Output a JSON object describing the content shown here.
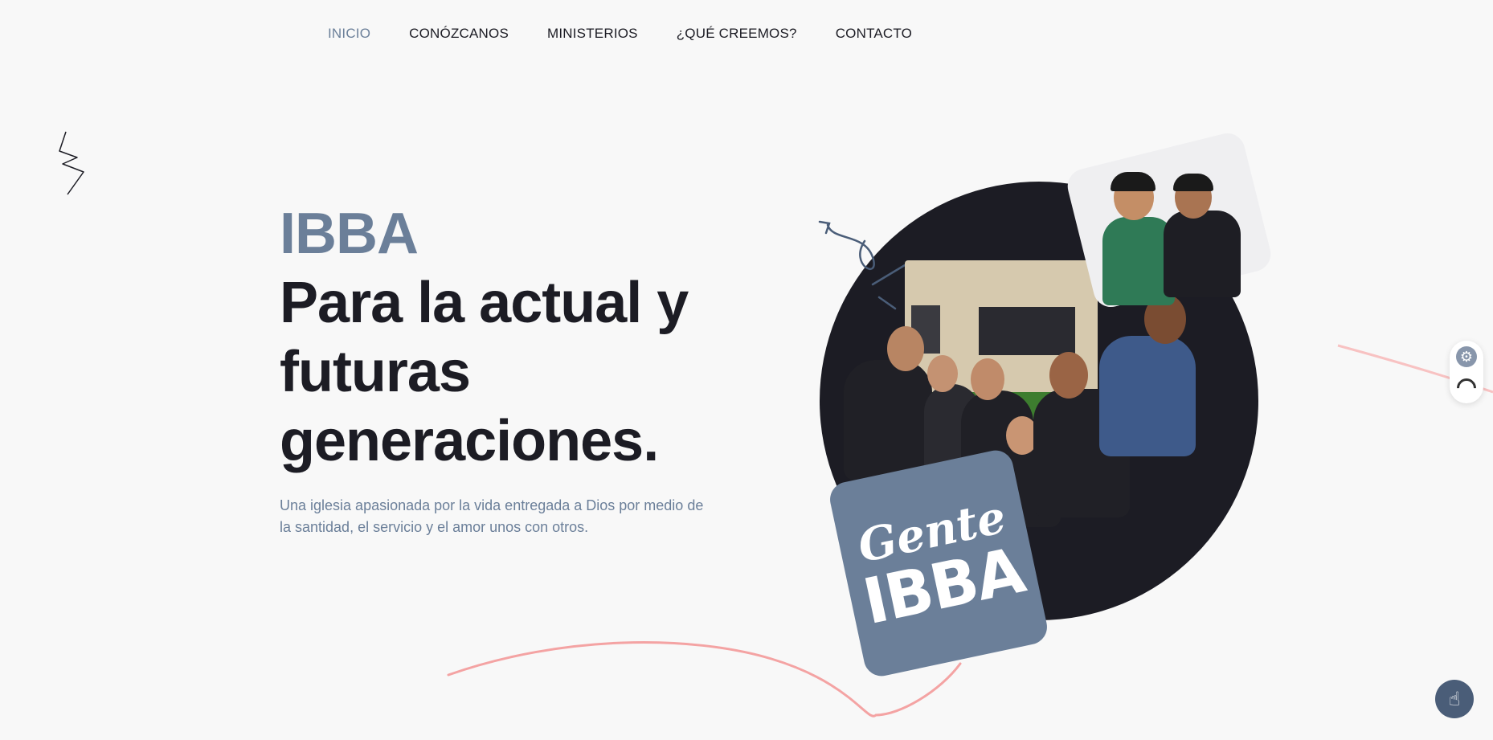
{
  "nav": {
    "items": [
      {
        "label": "INICIO",
        "active": true
      },
      {
        "label": "CONÓZCANOS",
        "active": false
      },
      {
        "label": "MINISTERIOS",
        "active": false
      },
      {
        "label": "¿QUÉ CREEMOS?",
        "active": false
      },
      {
        "label": "CONTACTO",
        "active": false
      }
    ]
  },
  "hero": {
    "brand": "IBBA",
    "headline_line1": "Para la actual y",
    "headline_line2": "futuras",
    "headline_line3": "generaciones.",
    "tagline": "Una iglesia apasionada por la vida entregada a Dios por medio de la santidad, el servicio y el amor unos con otros."
  },
  "badge": {
    "line1": "Gente",
    "line2": "IBBA"
  },
  "colors": {
    "accent": "#6b7f99",
    "dark": "#1c1c24",
    "background": "#f8f8f8",
    "wave": "#f4a3a3"
  },
  "widgets": {
    "settings_icon": "gear-icon",
    "theme_icon": "moon-icon",
    "accessibility_icon": "hand-pointer-icon"
  }
}
